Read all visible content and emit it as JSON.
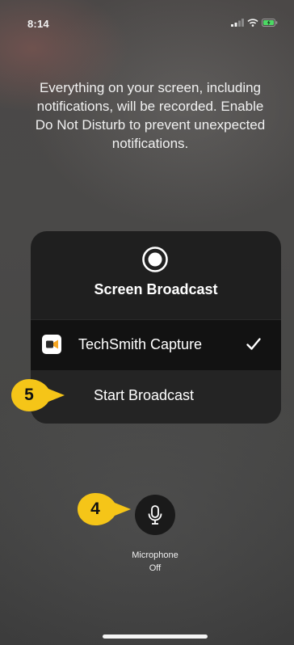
{
  "status_bar": {
    "time": "8:14",
    "icons": [
      "signal-icon",
      "wifi-icon",
      "battery-charging-icon"
    ]
  },
  "message": "Everything on your screen, including notifications, will be recorded. Enable Do Not Disturb to prevent unexpected notifications.",
  "broadcast_sheet": {
    "icon": "record-icon",
    "title": "Screen Broadcast",
    "app": {
      "icon": "techsmith-capture-icon",
      "name": "TechSmith Capture",
      "selected": true,
      "selected_icon": "checkmark-icon"
    },
    "start_label": "Start Broadcast"
  },
  "callouts": [
    {
      "number": "5",
      "color": "#f5c518"
    },
    {
      "number": "4",
      "color": "#f5c518"
    }
  ],
  "microphone": {
    "icon": "microphone-icon",
    "label": "Microphone",
    "state": "Off"
  },
  "colors": {
    "callout": "#f5c518",
    "app_icon_accent": "#f5a623"
  }
}
